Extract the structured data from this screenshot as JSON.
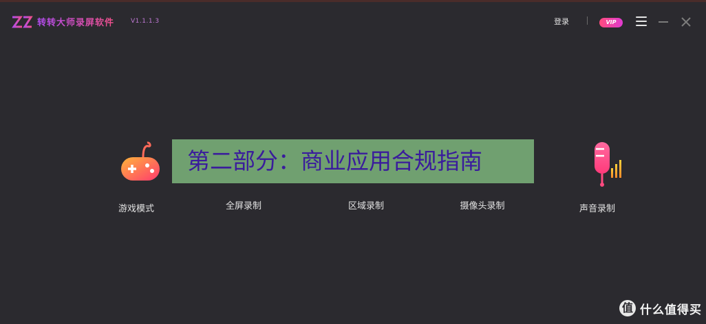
{
  "app": {
    "title": "转转大师录屏软件",
    "version": "V1.1.1.3"
  },
  "header": {
    "login_label": "登录",
    "vip_label": "VIP"
  },
  "modes": [
    {
      "label": "游戏模式",
      "icon": "gamepad-icon"
    },
    {
      "label": "全屏录制",
      "icon": "fullscreen-record-icon"
    },
    {
      "label": "区域录制",
      "icon": "region-record-icon"
    },
    {
      "label": "摄像头录制",
      "icon": "camera-record-icon"
    },
    {
      "label": "声音录制",
      "icon": "microphone-icon"
    }
  ],
  "overlay_text": "第二部分：商业应用合规指南",
  "watermark": {
    "symbol": "值",
    "text": "什么值得买"
  },
  "colors": {
    "background": "#2b2a2f",
    "accent_purple": "#b04cf0",
    "accent_pink": "#f0508a",
    "overlay_bg": "#70a070",
    "overlay_text": "#3a1c9c"
  }
}
